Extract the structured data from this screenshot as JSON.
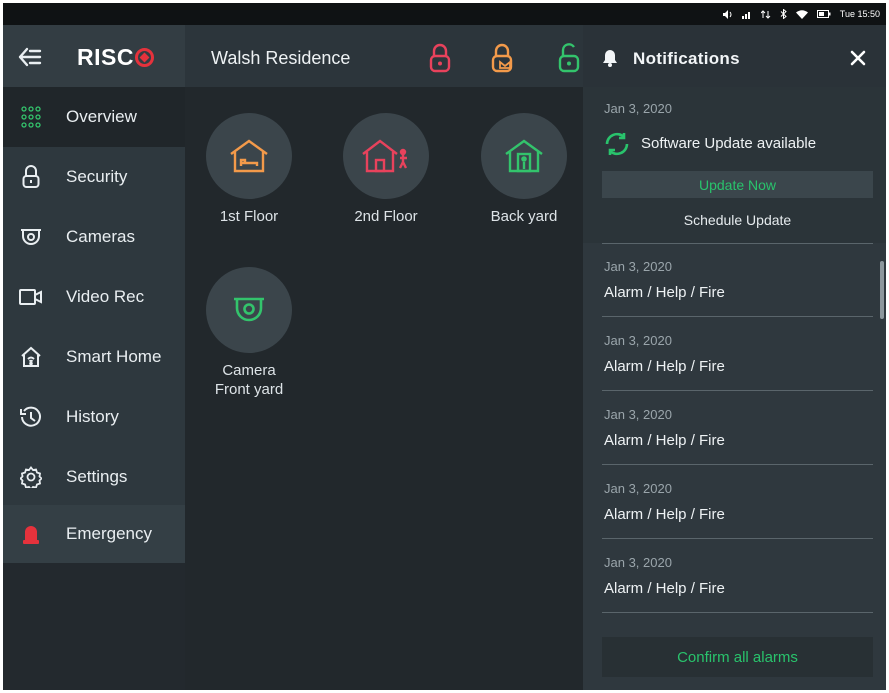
{
  "status_bar": {
    "time": "Tue 15:50"
  },
  "brand": {
    "logo_text": "RISC"
  },
  "header": {
    "site_name": "Walsh Residence"
  },
  "sidebar": {
    "items": [
      {
        "label": "Overview",
        "icon": "grid-icon"
      },
      {
        "label": "Security",
        "icon": "lock-icon"
      },
      {
        "label": "Cameras",
        "icon": "camera-icon"
      },
      {
        "label": "Video Rec",
        "icon": "video-icon"
      },
      {
        "label": "Smart Home",
        "icon": "smart-home-icon"
      },
      {
        "label": "History",
        "icon": "history-icon"
      },
      {
        "label": "Settings",
        "icon": "gear-icon"
      },
      {
        "label": "Emergency",
        "icon": "siren-icon"
      }
    ]
  },
  "tiles": [
    {
      "label": "1st Floor",
      "color": "#f39a4a"
    },
    {
      "label": "2nd Floor",
      "color": "#e8425c"
    },
    {
      "label": "Back yard",
      "color": "#33c46c"
    },
    {
      "label": "Camera\nFront yard",
      "color": "#33c46c"
    }
  ],
  "notifications": {
    "title": "Notifications",
    "software": {
      "date": "Jan 3, 2020",
      "title": "Software Update available",
      "update_label": "Update Now",
      "schedule_label": "Schedule Update"
    },
    "alarms": [
      {
        "date": "Jan 3, 2020",
        "title": "Alarm / Help / Fire"
      },
      {
        "date": "Jan 3, 2020",
        "title": "Alarm / Help / Fire"
      },
      {
        "date": "Jan 3, 2020",
        "title": "Alarm / Help / Fire"
      },
      {
        "date": "Jan 3, 2020",
        "title": "Alarm / Help / Fire"
      },
      {
        "date": "Jan 3, 2020",
        "title": "Alarm / Help / Fire"
      }
    ],
    "confirm_label": "Confirm all alarms"
  },
  "colors": {
    "accent_green": "#29c36c",
    "accent_red": "#e8425c",
    "accent_orange": "#f39a4a"
  }
}
